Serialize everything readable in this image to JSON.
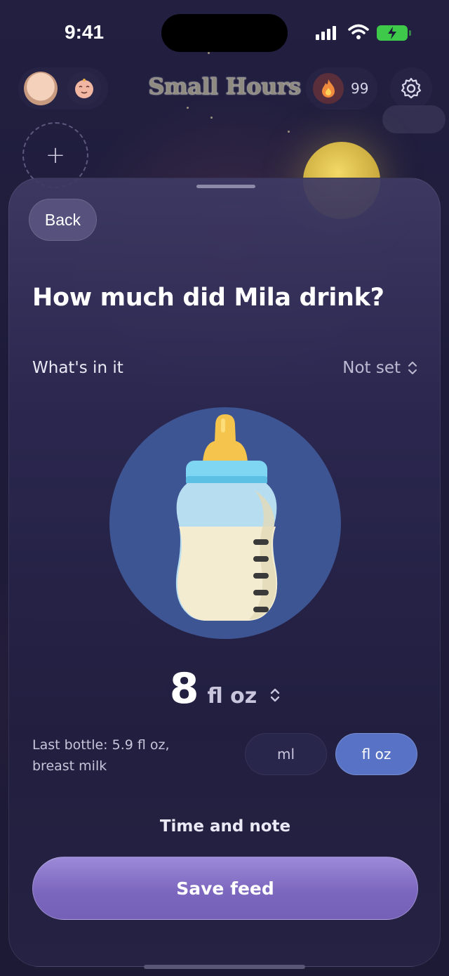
{
  "status_bar": {
    "time": "9:41"
  },
  "header": {
    "app_title": "Small Hours",
    "streak_count": "99",
    "add_child_symbol": "+"
  },
  "sheet": {
    "back_label": "Back",
    "question": "How much did Mila drink?",
    "contents_label": "What's in it",
    "contents_value": "Not set",
    "amount_value": "8",
    "amount_unit": "fl oz",
    "last_bottle": "Last bottle: 5.9 fl oz, breast milk",
    "unit_options": [
      "ml",
      "fl oz"
    ],
    "selected_unit": "fl oz",
    "time_note_label": "Time and note",
    "save_label": "Save feed"
  },
  "icons": {
    "bottle": "baby-bottle-icon",
    "settings": "gear-icon",
    "streak": "flame-icon",
    "contents_picker": "chevron-up-down-icon"
  },
  "colors": {
    "background": "#1e1b3a",
    "sheet": "#2c2850",
    "bottle_circle": "#3e5593",
    "unit_selected": "#5873c6",
    "save_button": "#7c67be"
  }
}
